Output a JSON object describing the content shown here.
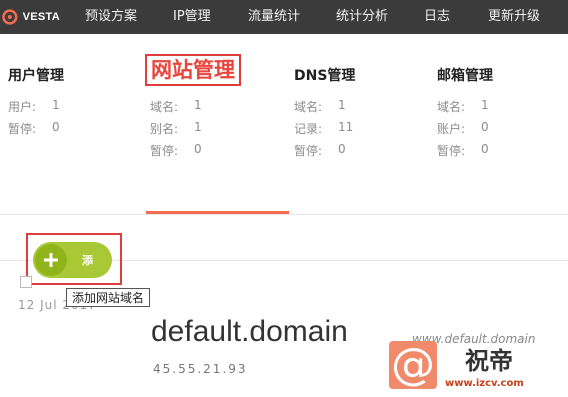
{
  "topbar": {
    "logo": "VESTA",
    "nav": [
      "预设方案",
      "IP管理",
      "流量统计",
      "统计分析",
      "日志",
      "更新升级"
    ]
  },
  "columns": [
    {
      "title": "用户管理",
      "stats": [
        {
          "label": "用户:",
          "value": "1"
        },
        {
          "label": "暂停:",
          "value": "0"
        }
      ]
    },
    {
      "title": "网站管理",
      "stats": [
        {
          "label": "域名:",
          "value": "1"
        },
        {
          "label": "别名:",
          "value": "1"
        },
        {
          "label": "暂停:",
          "value": "0"
        }
      ]
    },
    {
      "title": "DNS管理",
      "stats": [
        {
          "label": "域名:",
          "value": "1"
        },
        {
          "label": "记录:",
          "value": "11"
        },
        {
          "label": "暂停:",
          "value": "0"
        }
      ]
    },
    {
      "title": "邮箱管理",
      "stats": [
        {
          "label": "域名:",
          "value": "1"
        },
        {
          "label": "账户:",
          "value": "0"
        },
        {
          "label": "暂停:",
          "value": "0"
        }
      ]
    }
  ],
  "add_button": {
    "label": "添",
    "tooltip": "添加网站域名"
  },
  "domain_row": {
    "date": "12 Jul 2017",
    "name": "default.domain",
    "ip": "45.55.21.93",
    "alias": "www.default.domain"
  },
  "watermark": {
    "brand": "祝帝",
    "url": "www.izcv.com",
    "icon": "at-sign-icon"
  },
  "colors": {
    "topbar": "#3b3b3b",
    "active_tab": "#f26c4f",
    "add_button": "#a8c935",
    "highlight": "#e03c3c"
  }
}
